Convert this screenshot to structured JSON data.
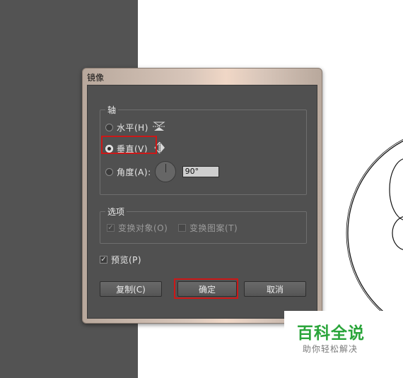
{
  "dialog": {
    "title": "镜像",
    "axis": {
      "legend": "轴",
      "horizontal_label": "水平(H)",
      "vertical_label": "垂直(V)",
      "angle_label": "角度(A):",
      "angle_value": "90°",
      "selected": "vertical"
    },
    "options": {
      "legend": "选项",
      "transform_objects_label": "变换对象(O)",
      "transform_objects_checked": true,
      "transform_patterns_label": "变换图案(T)",
      "transform_patterns_checked": false
    },
    "preview": {
      "label": "预览(P)",
      "checked": true
    },
    "buttons": {
      "copy": "复制(C)",
      "ok": "确定",
      "cancel": "取消"
    }
  },
  "watermark": {
    "title": "百科全说",
    "subtitle": "助你轻松解决"
  },
  "colors": {
    "highlight": "#cc1818",
    "watermark_green": "#2aa53a",
    "workspace": "#535353"
  },
  "icons": [
    "horizontal-reflect-icon",
    "vertical-reflect-icon",
    "angle-dial-icon",
    "check-icon"
  ]
}
